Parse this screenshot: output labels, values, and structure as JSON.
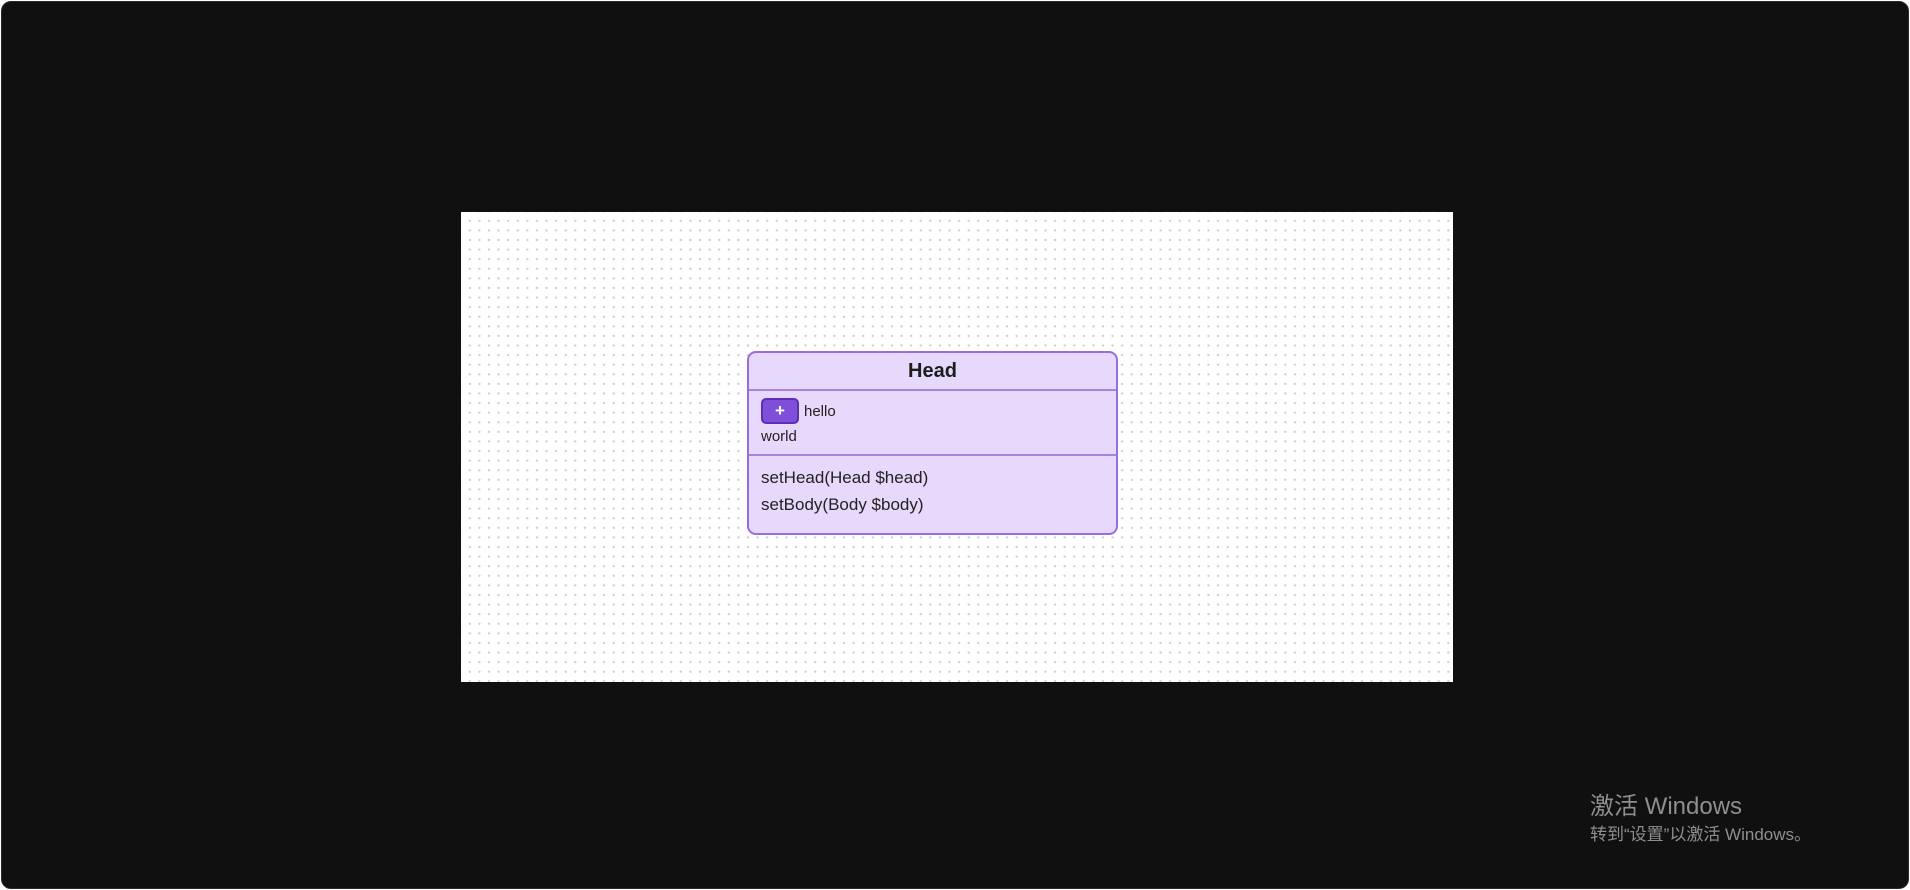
{
  "uml_class": {
    "title": "Head",
    "add_button_label": "+",
    "properties": [
      "hello",
      "world"
    ],
    "methods": [
      "setHead(Head $head)",
      "setBody(Body $body)"
    ]
  },
  "watermark": {
    "title": "激活 Windows",
    "subtitle": "转到“设置”以激活 Windows。"
  },
  "colors": {
    "frame_background": "#101010",
    "canvas_background": "#ffffff",
    "node_fill": "#e6d9fc",
    "node_border": "#9b6cdc",
    "add_button_fill": "#7f4fd9"
  },
  "icons": {
    "add": "plus-icon"
  }
}
